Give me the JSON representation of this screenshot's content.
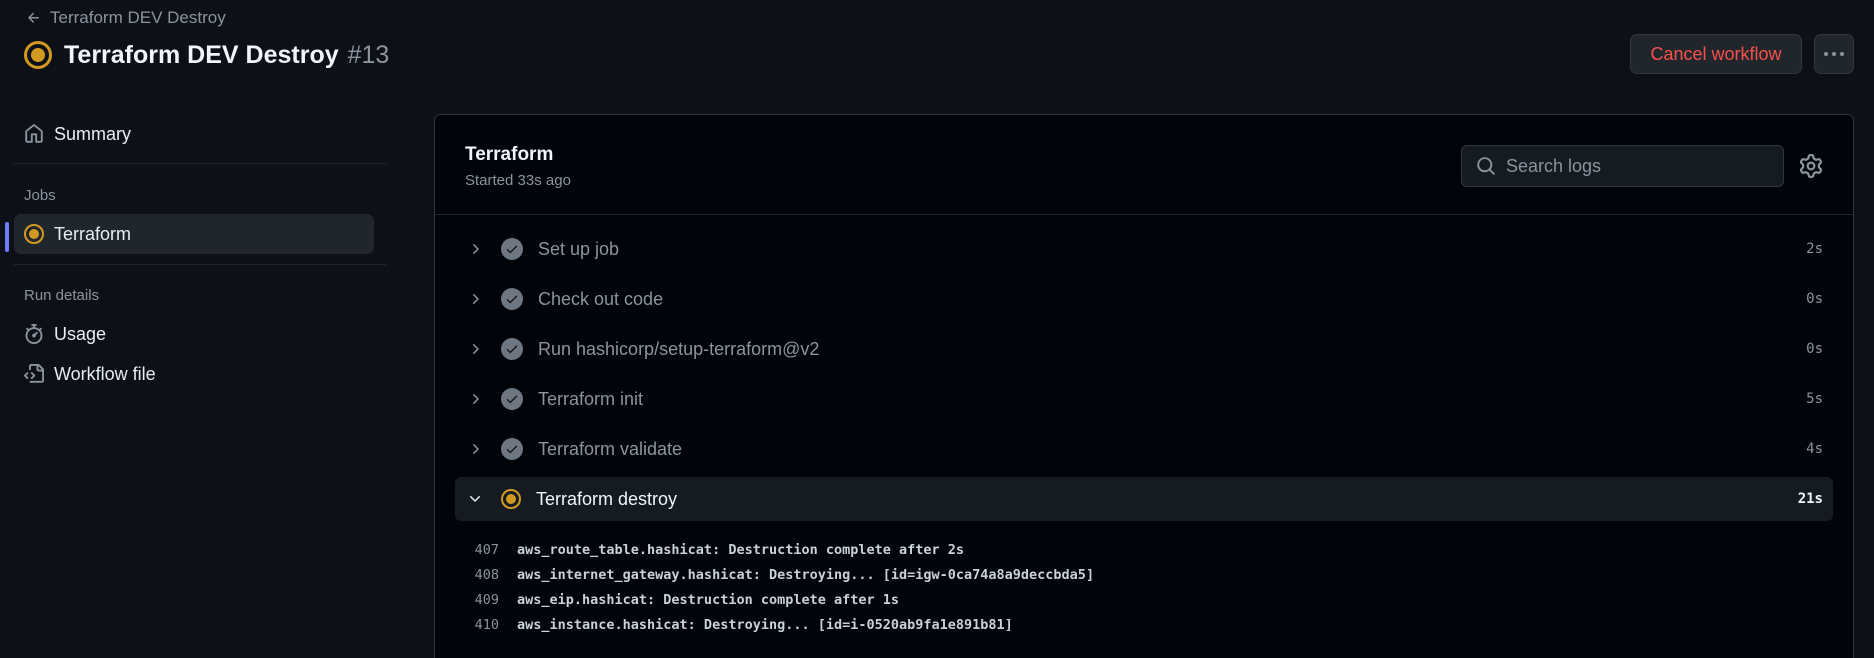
{
  "header": {
    "back_label": "Terraform DEV Destroy",
    "title": "Terraform DEV Destroy",
    "run_number": "#13",
    "cancel_label": "Cancel workflow",
    "status_color": "#d29922"
  },
  "sidebar": {
    "summary": "Summary",
    "jobs_heading": "Jobs",
    "job": "Terraform",
    "run_details_heading": "Run details",
    "usage": "Usage",
    "workflow_file": "Workflow file"
  },
  "job": {
    "title": "Terraform",
    "subtitle": "Started 33s ago",
    "search_placeholder": "Search logs",
    "steps": [
      {
        "label": "Set up job",
        "duration": "2s",
        "status": "success"
      },
      {
        "label": "Check out code",
        "duration": "0s",
        "status": "success"
      },
      {
        "label": "Run hashicorp/setup-terraform@v2",
        "duration": "0s",
        "status": "success"
      },
      {
        "label": "Terraform init",
        "duration": "5s",
        "status": "success"
      },
      {
        "label": "Terraform validate",
        "duration": "4s",
        "status": "success"
      },
      {
        "label": "Terraform destroy",
        "duration": "21s",
        "status": "in_progress"
      }
    ],
    "logs": [
      {
        "num": "407",
        "text": "aws_route_table.hashicat: Destruction complete after 2s"
      },
      {
        "num": "408",
        "text": "aws_internet_gateway.hashicat: Destroying... [id=igw-0ca74a8a9deccbda5]"
      },
      {
        "num": "409",
        "text": "aws_eip.hashicat: Destruction complete after 1s"
      },
      {
        "num": "410",
        "text": "aws_instance.hashicat: Destroying... [id=i-0520ab9fa1e891b81]"
      }
    ]
  },
  "colors": {
    "accent": "#6e7cff",
    "danger": "#f85149",
    "in_progress": "#d29922"
  }
}
